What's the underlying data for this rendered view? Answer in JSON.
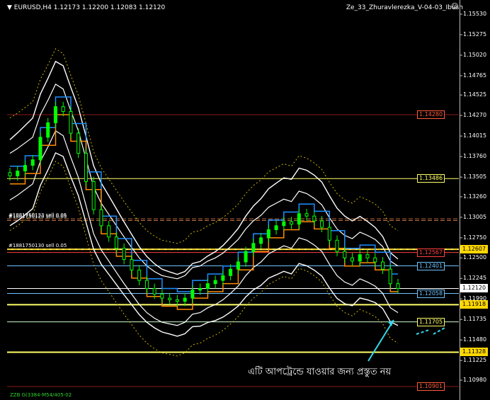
{
  "header": {
    "symbol_title": "EURUSD,H4  1.12173 1.12200 1.12083 1.12120",
    "indicator_name": "Ze_33_Zhuravlerezka_V-04-03_Ibush"
  },
  "footer": {
    "label": "ZZB G(3384-M54/405-02"
  },
  "annotation": {
    "text": "এটি আপট্রেন্ডে যাওয়ার জন্য প্রস্তুত নয়"
  },
  "chart_data": {
    "type": "candlestick",
    "symbol": "EURUSD",
    "timeframe": "H4",
    "ohlc_last": {
      "open": 1.12173,
      "high": 1.122,
      "low": 1.12083,
      "close": 1.1212
    },
    "ylim": [
      1.10845,
      1.11575
    ],
    "grid": false,
    "price_ticks": [
      "1.15530",
      "1.15530",
      "1.15275",
      "1.15020",
      "1.14765",
      "1.14525",
      "1.14270",
      "1.14015",
      "1.13760",
      "1.13505",
      "1.13260",
      "1.13005",
      "1.12750",
      "1.12500",
      "1.12245",
      "1.11990",
      "1.11735",
      "1.11480",
      "1.11225",
      "1.10980"
    ],
    "levels": [
      {
        "label": "1.14280",
        "value": 1.1428,
        "color": "#ff5a3c",
        "line": "#8b1a1a",
        "tagged": false
      },
      {
        "label": "1.13486",
        "value": 1.13486,
        "color": "#ffff66",
        "line": "#ffff66",
        "tagged": false
      },
      {
        "label": "1.12607",
        "value": 1.12607,
        "color": "#ffd700",
        "line": "#ffff66",
        "tagged": true
      },
      {
        "label": "1.12567",
        "value": 1.12567,
        "color": "#ff4040",
        "line": "#ff4040",
        "tagged": false
      },
      {
        "label": "1.12401",
        "value": 1.12401,
        "color": "#6fc3ff",
        "line": "#6fc3ff",
        "tagged": false
      },
      {
        "label": "1.12120",
        "value": 1.1212,
        "color": "#ffffff",
        "line": "#ffffff",
        "tagged": true
      },
      {
        "label": "1.12058",
        "value": 1.12058,
        "color": "#6fc3ff",
        "line": "#6fc3ff",
        "tagged": false
      },
      {
        "label": "1.11918",
        "value": 1.11918,
        "color": "#ffd700",
        "line": "#ffff66",
        "tagged": true
      },
      {
        "label": "1.11705",
        "value": 1.11705,
        "color": "#ffff66",
        "line": "#ccffcc",
        "tagged": false
      },
      {
        "label": "1.11328",
        "value": 1.11328,
        "color": "#ffd700",
        "line": "#ffff66",
        "tagged": true
      },
      {
        "label": "1.10901",
        "value": 1.10901,
        "color": "#ff5a3c",
        "line": "#8b1a1a",
        "tagged": false
      }
    ],
    "orders": [
      {
        "label": "#1881750133 sell 0.05",
        "value": 1.12985
      },
      {
        "label": "#1881750120 sell 0.05",
        "value": 1.12965
      },
      {
        "label": "#1881750130 sell 0.05",
        "value": 1.12607
      }
    ],
    "series": [
      {
        "name": "",
        "color": "#00ff00",
        "kind": "candles"
      },
      {
        "name": "",
        "color": "#ffffff",
        "kind": "bands"
      },
      {
        "name": "",
        "color": "#1e90ff",
        "kind": "step"
      },
      {
        "name": "",
        "color": "#ff8c00",
        "kind": "step"
      },
      {
        "name": "",
        "color": "#c8b400",
        "kind": "dotted"
      }
    ],
    "price_path": [
      1.1352,
      1.1358,
      1.1365,
      1.1372,
      1.14,
      1.1418,
      1.1438,
      1.1432,
      1.1405,
      1.138,
      1.1345,
      1.131,
      1.129,
      1.1276,
      1.1262,
      1.1248,
      1.1235,
      1.1222,
      1.1212,
      1.1205,
      1.12,
      1.1198,
      1.1196,
      1.12,
      1.121,
      1.1212,
      1.1218,
      1.1222,
      1.1228,
      1.1236,
      1.1245,
      1.1258,
      1.1268,
      1.1275,
      1.1285,
      1.129,
      1.1295,
      1.1292,
      1.1305,
      1.1302,
      1.1296,
      1.1288,
      1.1272,
      1.1258,
      1.125,
      1.1246,
      1.1254,
      1.125,
      1.1245,
      1.1236,
      1.1218,
      1.1212
    ]
  }
}
